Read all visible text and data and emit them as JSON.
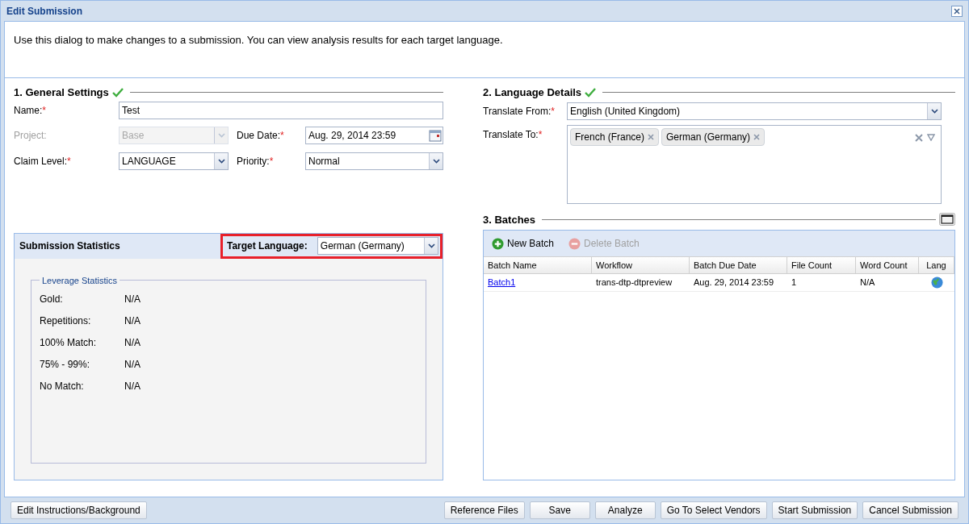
{
  "window": {
    "title": "Edit Submission"
  },
  "intro": "Use this dialog to make changes to a submission. You can view analysis results for each target language.",
  "general_settings": {
    "title": "1. General Settings",
    "valid": true,
    "name": {
      "label": "Name:",
      "required_mark": "*",
      "value": "Test"
    },
    "project": {
      "label": "Project:",
      "disabled": true,
      "value": "Base"
    },
    "due_date": {
      "label": "Due Date:",
      "required_mark": "*",
      "value": "Aug. 29, 2014 23:59"
    },
    "claim_level": {
      "label": "Claim Level:",
      "required_mark": "*",
      "disabled": false,
      "value": "LANGUAGE"
    },
    "priority": {
      "label": "Priority:",
      "required_mark": "*",
      "disabled": false,
      "value": "Normal"
    }
  },
  "statistics": {
    "title": "Submission Statistics",
    "target_label": "Target Language:",
    "target_value": "German (Germany)",
    "legend": "Leverage Statistics",
    "rows": [
      {
        "label": "Gold:",
        "value": "N/A"
      },
      {
        "label": "Repetitions:",
        "value": "N/A"
      },
      {
        "label": "100% Match:",
        "value": "N/A"
      },
      {
        "label": "75% - 99%:",
        "value": "N/A"
      },
      {
        "label": "No Match:",
        "value": "N/A"
      }
    ]
  },
  "language_details": {
    "title": "2. Language Details",
    "valid": true,
    "from": {
      "label": "Translate From:",
      "required_mark": "*",
      "value": "English (United Kingdom)"
    },
    "to": {
      "label": "Translate To:",
      "required_mark": "*",
      "tags": [
        "French (France)",
        "German (Germany)"
      ]
    }
  },
  "batches": {
    "title": "3. Batches",
    "toolbar": [
      {
        "label": "New Batch",
        "kind": "add",
        "disabled": false
      },
      {
        "label": "Delete Batch",
        "kind": "delete",
        "disabled": true
      }
    ],
    "columns": [
      "Batch Name",
      "Workflow",
      "Batch Due Date",
      "File Count",
      "Word Count",
      "Lang"
    ],
    "rows": [
      {
        "name": "Batch1",
        "workflow": "trans-dtp-dtpreview",
        "due": "Aug. 29, 2014 23:59",
        "files": "1",
        "words": "N/A"
      }
    ]
  },
  "footer_left": [
    "Edit Instructions/Background"
  ],
  "footer_right": [
    "Reference Files",
    "Save",
    "Analyze",
    "Go To Select Vendors",
    "Start Submission",
    "Cancel Submission"
  ]
}
